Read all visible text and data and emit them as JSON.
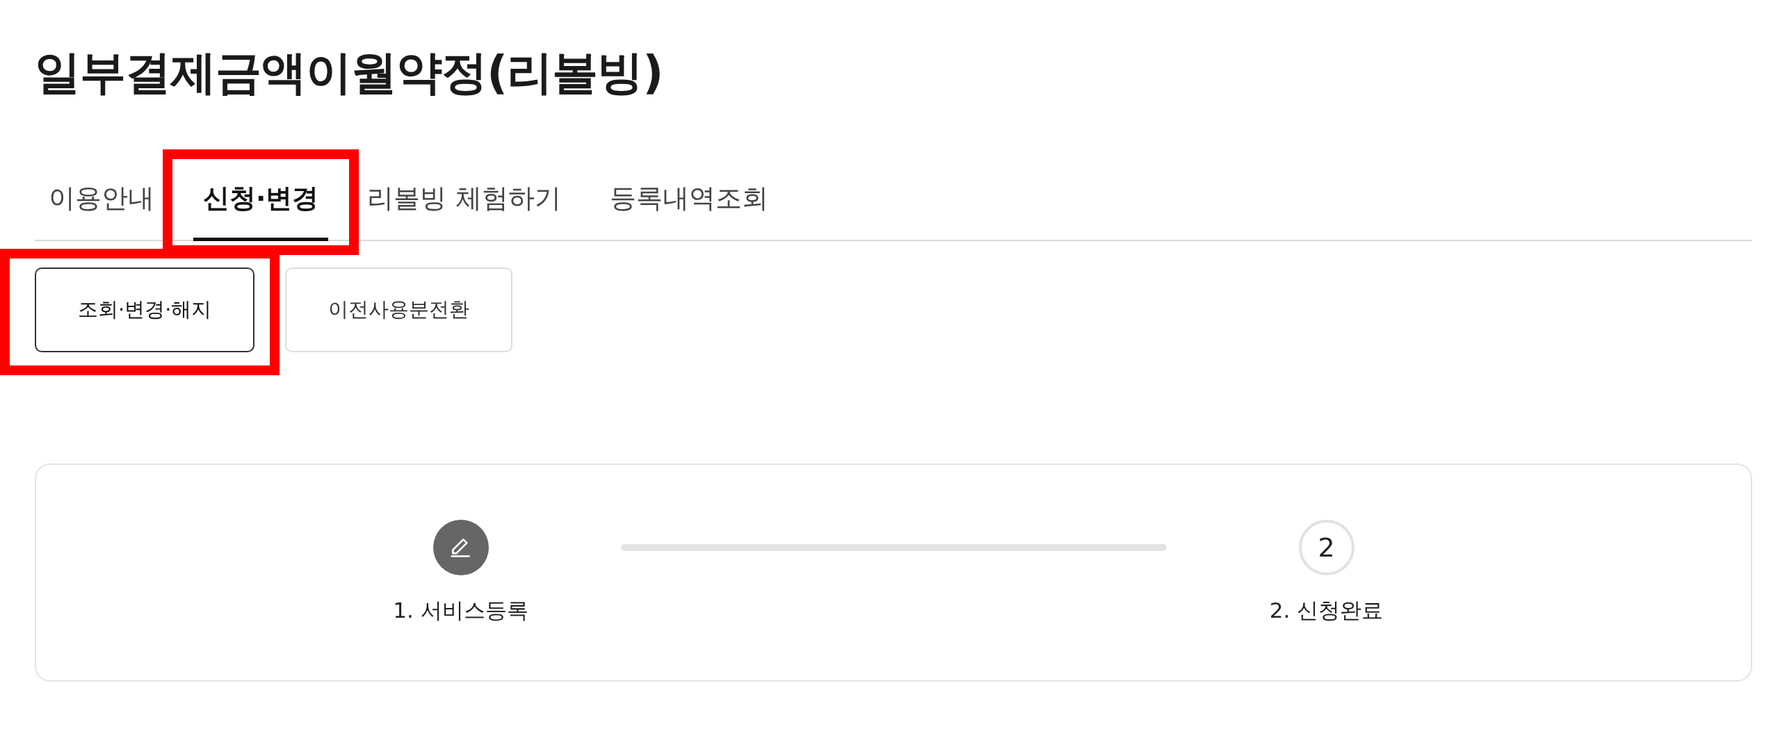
{
  "title": "일부결제금액이월약정(리볼빙)",
  "tabs": [
    {
      "label": "이용안내",
      "selected": false,
      "highlighted": false
    },
    {
      "label": "신청·변경",
      "selected": true,
      "highlighted": true
    },
    {
      "label": "리볼빙 체험하기",
      "selected": false,
      "highlighted": false
    },
    {
      "label": "등록내역조회",
      "selected": false,
      "highlighted": false
    }
  ],
  "sub_tabs": [
    {
      "label": "조회·변경·해지",
      "selected": true,
      "highlighted": true
    },
    {
      "label": "이전사용분전환",
      "selected": false,
      "highlighted": false
    }
  ],
  "steps": [
    {
      "done": true,
      "label": "1. 서비스등록"
    },
    {
      "done": false,
      "number": "2",
      "label": "2. 신청완료"
    }
  ]
}
